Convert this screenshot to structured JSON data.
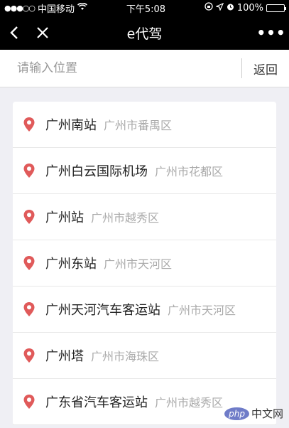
{
  "status_bar": {
    "signal": "●●●○○",
    "carrier": "中国移动",
    "time": "下午5:08",
    "battery_text": "100%"
  },
  "nav": {
    "title": "e代驾",
    "more": "•••"
  },
  "search": {
    "placeholder": "请输入位置",
    "back_label": "返回"
  },
  "results": [
    {
      "name": "广州南站",
      "district": "广州市番禺区"
    },
    {
      "name": "广州白云国际机场",
      "district": "广州市花都区"
    },
    {
      "name": "广州站",
      "district": "广州市越秀区"
    },
    {
      "name": "广州东站",
      "district": "广州市天河区"
    },
    {
      "name": "广州天河汽车客运站",
      "district": "广州市天河区"
    },
    {
      "name": "广州塔",
      "district": "广州市海珠区"
    },
    {
      "name": "广东省汽车客运站",
      "district": "广州市越秀区"
    }
  ],
  "watermark": {
    "logo": "php",
    "text": "中文网"
  },
  "colors": {
    "pin": "#e05a5a",
    "nav_bg": "#000000"
  }
}
